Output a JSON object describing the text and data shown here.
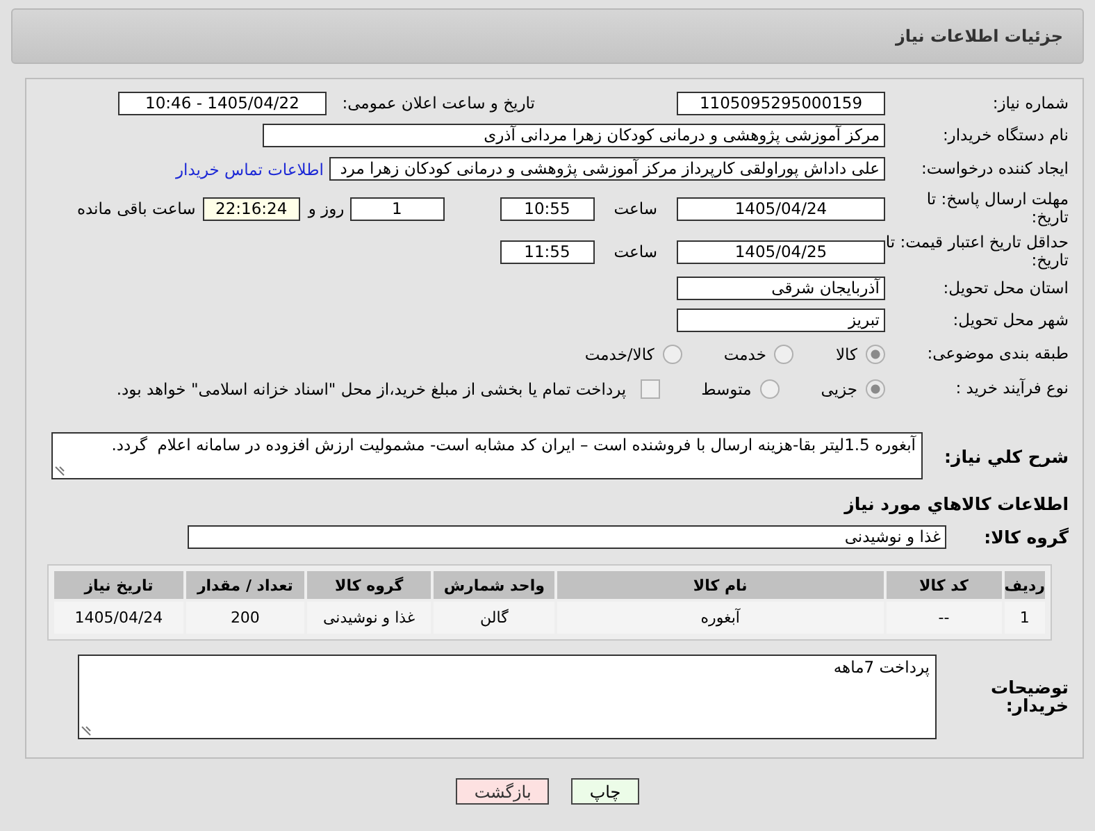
{
  "header": {
    "title": "جزئیات اطلاعات نیاز"
  },
  "need_number": {
    "label": "شماره نیاز:",
    "value": "1105095295000159"
  },
  "announce": {
    "label": "تاریخ و ساعت اعلان عمومی:",
    "value": "1405/04/22 - 10:46"
  },
  "buyer_org": {
    "label": "نام دستگاه خریدار:",
    "value": "مرکز آموزشی پژوهشی و درمانی کودکان زهرا مردانی آذری"
  },
  "requester": {
    "label": "ایجاد کننده درخواست:",
    "value": "علی داداش پوراولقی کارپرداز مرکز آموزشی پژوهشی و درمانی کودکان زهرا مرد",
    "link": "اطلاعات تماس خریدار"
  },
  "deadline": {
    "label": "مهلت ارسال پاسخ: تا تاریخ:",
    "date": "1405/04/24",
    "time_label": "ساعت",
    "time": "10:55",
    "days": "1",
    "days_label": "روز و",
    "remaining": "22:16:24",
    "remaining_label": "ساعت باقی مانده"
  },
  "price_validity": {
    "label": "حداقل تاریخ اعتبار قیمت: تا تاریخ:",
    "date": "1405/04/25",
    "time_label": "ساعت",
    "time": "11:55"
  },
  "province": {
    "label": "استان محل تحویل:",
    "value": "آذربایجان شرقی"
  },
  "city": {
    "label": "شهر محل تحویل:",
    "value": "تبریز"
  },
  "category": {
    "label": "طبقه بندی موضوعی:",
    "options": [
      {
        "label": "کالا",
        "selected": true
      },
      {
        "label": "خدمت",
        "selected": false
      },
      {
        "label": "کالا/خدمت",
        "selected": false
      }
    ]
  },
  "purchase_type": {
    "label": "نوع فرآیند خرید :",
    "options": [
      {
        "label": "جزیی",
        "selected": true
      },
      {
        "label": "متوسط",
        "selected": false
      }
    ],
    "payment": {
      "label": "پرداخت تمام یا بخشی از مبلغ خرید،از محل \"اسناد خزانه اسلامی\" خواهد بود.",
      "checked": false
    }
  },
  "description": {
    "label": "شرح كلي نياز:",
    "value": "آبغوره 1.5لیتر بقا-هزینه ارسال با فروشنده است – ایران کد مشابه است- مشمولیت ارزش افزوده در سامانه اعلام  گردد."
  },
  "goods_section": {
    "title": "اطلاعات كالاهاي مورد نياز"
  },
  "goods_group": {
    "label": "گروه کالا:",
    "value": "غذا و نوشیدنی"
  },
  "table": {
    "columns": [
      "ردیف",
      "کد کالا",
      "نام کالا",
      "واحد شمارش",
      "گروه کالا",
      "تعداد / مقدار",
      "تاریخ نیاز"
    ],
    "rows": [
      [
        "1",
        "--",
        "آبغوره",
        "گالن",
        "غذا و نوشیدنی",
        "200",
        "1405/04/24"
      ]
    ]
  },
  "buyer_notes": {
    "label": "توضیحات خریدار:",
    "value": "پرداخت 7ماهه"
  },
  "buttons": [
    {
      "label": "چاپ",
      "kind": "print"
    },
    {
      "label": "بازگشت",
      "kind": "back"
    }
  ]
}
